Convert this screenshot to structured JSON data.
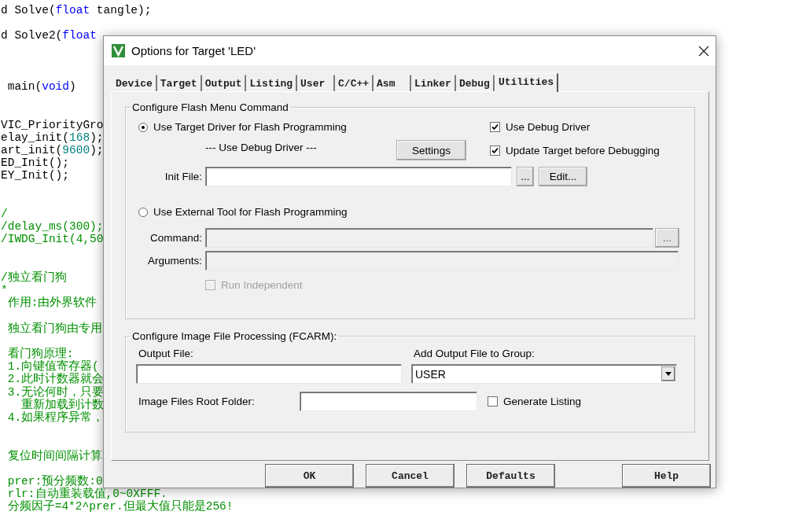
{
  "editor": {
    "lines": [
      {
        "kind": "code",
        "segments": [
          {
            "text": "d Solve(",
            "kind": "plain"
          },
          {
            "text": "float",
            "kind": "keyword"
          },
          {
            "text": " tangle);",
            "kind": "plain"
          }
        ]
      },
      {
        "kind": "blank"
      },
      {
        "kind": "code",
        "segments": [
          {
            "text": "d Solve2(",
            "kind": "plain"
          },
          {
            "text": "float",
            "kind": "keyword"
          }
        ]
      },
      {
        "kind": "blank"
      },
      {
        "kind": "blank"
      },
      {
        "kind": "blank"
      },
      {
        "kind": "code",
        "segments": [
          {
            "text": " main(",
            "kind": "plain"
          },
          {
            "text": "void",
            "kind": "keyword"
          },
          {
            "text": ")",
            "kind": "plain"
          }
        ]
      },
      {
        "kind": "blank"
      },
      {
        "kind": "blank"
      },
      {
        "kind": "code",
        "segments": [
          {
            "text": "VIC_PriorityGro",
            "kind": "plain"
          }
        ]
      },
      {
        "kind": "code",
        "segments": [
          {
            "text": "elay_init(",
            "kind": "plain"
          },
          {
            "text": "168",
            "kind": "number"
          },
          {
            "text": ");",
            "kind": "plain"
          }
        ]
      },
      {
        "kind": "code",
        "segments": [
          {
            "text": "art_init(",
            "kind": "plain"
          },
          {
            "text": "9600",
            "kind": "number"
          },
          {
            "text": ");",
            "kind": "plain"
          }
        ]
      },
      {
        "kind": "code",
        "segments": [
          {
            "text": "ED_Init();",
            "kind": "plain"
          }
        ]
      },
      {
        "kind": "code",
        "segments": [
          {
            "text": "EY_Init();",
            "kind": "plain"
          }
        ]
      },
      {
        "kind": "blank"
      },
      {
        "kind": "blank"
      },
      {
        "kind": "code",
        "segments": [
          {
            "text": "/",
            "kind": "comment"
          }
        ]
      },
      {
        "kind": "code",
        "segments": [
          {
            "text": "/delay_ms(300);",
            "kind": "comment"
          }
        ]
      },
      {
        "kind": "code",
        "segments": [
          {
            "text": "/IWDG_Init(4,50",
            "kind": "comment"
          }
        ]
      },
      {
        "kind": "blank"
      },
      {
        "kind": "blank"
      },
      {
        "kind": "code",
        "segments": [
          {
            "text": "/独立看门狗",
            "kind": "comment"
          }
        ]
      },
      {
        "kind": "code",
        "segments": [
          {
            "text": "*",
            "kind": "comment"
          }
        ]
      },
      {
        "kind": "code",
        "segments": [
          {
            "text": " 作用:由外界软件",
            "kind": "comment"
          }
        ]
      },
      {
        "kind": "blank"
      },
      {
        "kind": "code",
        "segments": [
          {
            "text": " 独立看门狗由专用",
            "kind": "comment"
          }
        ]
      },
      {
        "kind": "blank"
      },
      {
        "kind": "code",
        "segments": [
          {
            "text": " 看门狗原理:",
            "kind": "comment"
          }
        ]
      },
      {
        "kind": "code",
        "segments": [
          {
            "text": " 1.向键值寄存器(",
            "kind": "comment"
          }
        ]
      },
      {
        "kind": "code",
        "segments": [
          {
            "text": " 2.此时计数器就会",
            "kind": "comment"
          }
        ]
      },
      {
        "kind": "code",
        "segments": [
          {
            "text": " 3.无论何时，只要",
            "kind": "comment"
          }
        ]
      },
      {
        "kind": "code",
        "segments": [
          {
            "text": "   重新加载到计数",
            "kind": "comment"
          }
        ]
      },
      {
        "kind": "code",
        "segments": [
          {
            "text": " 4.如果程序异常，",
            "kind": "comment"
          }
        ]
      },
      {
        "kind": "blank"
      },
      {
        "kind": "blank"
      },
      {
        "kind": "code",
        "segments": [
          {
            "text": " 复位时间间隔计算",
            "kind": "comment"
          }
        ]
      },
      {
        "kind": "blank"
      },
      {
        "kind": "code",
        "segments": [
          {
            "text": " prer:预分频数:0",
            "kind": "comment"
          }
        ]
      },
      {
        "kind": "code",
        "segments": [
          {
            "text": " rlr:自动重装载值,0~0XFFF.",
            "kind": "comment"
          }
        ]
      },
      {
        "kind": "code",
        "segments": [
          {
            "text": " 分频因子=4*2^prer.但最大值只能是256!",
            "kind": "comment"
          }
        ]
      }
    ]
  },
  "dialog": {
    "title": "Options for Target 'LED'",
    "tabs": [
      {
        "label": "Device",
        "selected": false
      },
      {
        "label": "Target",
        "selected": false
      },
      {
        "label": "Output",
        "selected": false
      },
      {
        "label": "Listing",
        "selected": false
      },
      {
        "label": "User",
        "selected": false
      },
      {
        "label": "C/C++",
        "selected": false
      },
      {
        "label": "Asm",
        "selected": false
      },
      {
        "label": "Linker",
        "selected": false
      },
      {
        "label": "Debug",
        "selected": false
      },
      {
        "label": "Utilities",
        "selected": true
      }
    ],
    "flash_group": {
      "title": "Configure Flash Menu Command",
      "target_driver": {
        "label": "Use Target Driver for Flash Programming",
        "selected": true
      },
      "driver_label": "--- Use Debug Driver ---",
      "settings_button": "Settings",
      "use_debug_driver": {
        "label": "Use Debug Driver",
        "checked": true
      },
      "update_target": {
        "label": "Update Target before Debugging",
        "checked": true
      },
      "init_file": {
        "label": "Init File:",
        "browse_button": "...",
        "edit_button": "Edit..."
      },
      "external_tool": {
        "label": "Use External Tool for Flash Programming",
        "selected": false
      },
      "command": {
        "label": "Command:",
        "disabled": true,
        "browse_button": "..."
      },
      "arguments": {
        "label": "Arguments:",
        "disabled": true
      },
      "run_independent": {
        "label": "Run Independent",
        "checked": false,
        "disabled": true
      }
    },
    "image_group": {
      "title": "Configure Image File Processing (FCARM):",
      "output_file": {
        "label": "Output File:"
      },
      "add_to_group": {
        "label": "Add Output File  to Group:",
        "value": "USER"
      },
      "root_folder": {
        "label": "Image Files Root Folder:"
      },
      "generate_listing": {
        "label": "Generate Listing",
        "checked": false
      }
    },
    "buttons": [
      {
        "label": "OK"
      },
      {
        "label": "Cancel"
      },
      {
        "label": "Defaults"
      },
      {
        "label": "Help"
      }
    ]
  }
}
